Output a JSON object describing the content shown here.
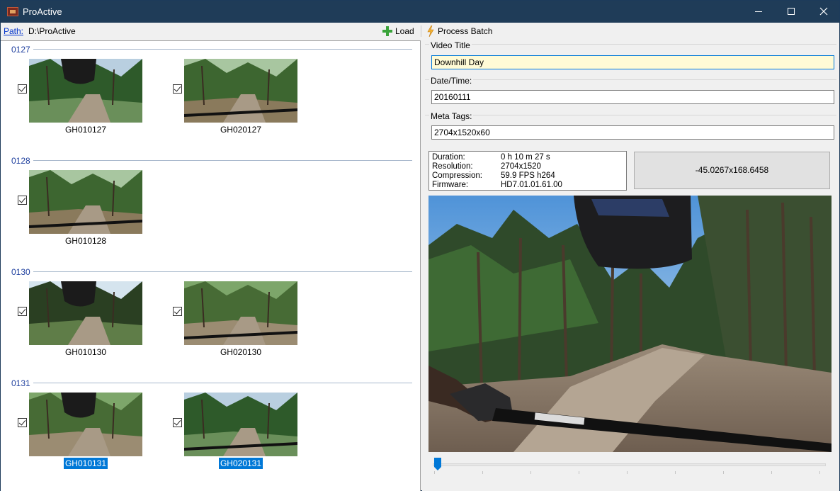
{
  "window": {
    "title": "ProActive"
  },
  "toolbar": {
    "path_label": "Path:",
    "path_value": "D:\\ProActive",
    "load_label": "Load",
    "process_label": "Process Batch"
  },
  "groups": [
    {
      "name": "0127",
      "items": [
        {
          "label": "GH010127",
          "checked": true,
          "selected": false
        },
        {
          "label": "GH020127",
          "checked": true,
          "selected": false
        }
      ]
    },
    {
      "name": "0128",
      "items": [
        {
          "label": "GH010128",
          "checked": true,
          "selected": false
        }
      ]
    },
    {
      "name": "0130",
      "items": [
        {
          "label": "GH010130",
          "checked": true,
          "selected": false
        },
        {
          "label": "GH020130",
          "checked": true,
          "selected": false
        }
      ]
    },
    {
      "name": "0131",
      "items": [
        {
          "label": "GH010131",
          "checked": true,
          "selected": true
        },
        {
          "label": "GH020131",
          "checked": true,
          "selected": true
        }
      ]
    }
  ],
  "details": {
    "video_title_label": "Video Title",
    "video_title_value": "Downhill Day",
    "datetime_label": "Date/Time:",
    "datetime_value": "20160111",
    "meta_tags_label": "Meta Tags:",
    "meta_tags_value": "2704x1520x60"
  },
  "info": {
    "duration_key": "Duration:",
    "duration_value": "0 h 10 m 27 s",
    "resolution_key": "Resolution:",
    "resolution_value": "2704x1520",
    "compression_key": "Compression:",
    "compression_value": "59.9 FPS h264",
    "firmware_key": "Firmware:",
    "firmware_value": "HD7.01.01.61.00"
  },
  "gps": {
    "value": "-45.0267x168.6458"
  },
  "timeline": {
    "position": 0.0
  },
  "colors": {
    "titlebar": "#1f3c58",
    "accent": "#0078d7",
    "group_header": "#1e3f9e",
    "active_input": "#fffbd6"
  }
}
